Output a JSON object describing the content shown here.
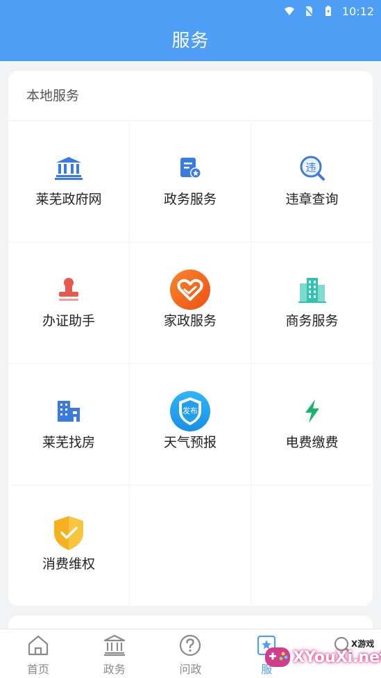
{
  "status_bar": {
    "time": "10:12"
  },
  "header": {
    "title": "服务"
  },
  "local_services": {
    "section_title": "本地服务",
    "items": [
      {
        "label": "莱芜政府网",
        "icon": "government-building-icon"
      },
      {
        "label": "政务服务",
        "icon": "document-badge-icon"
      },
      {
        "label": "违章查询",
        "icon": "violation-search-icon"
      },
      {
        "label": "办证助手",
        "icon": "stamp-icon"
      },
      {
        "label": "家政服务",
        "icon": "heart-hands-icon"
      },
      {
        "label": "商务服务",
        "icon": "office-buildings-icon"
      },
      {
        "label": "莱芜找房",
        "icon": "house-buildings-icon"
      },
      {
        "label": "天气预报",
        "icon": "shield-publish-icon",
        "badge_text": "发布"
      },
      {
        "label": "电费缴费",
        "icon": "lightning-icon"
      },
      {
        "label": "消费维权",
        "icon": "shield-check-icon"
      }
    ]
  },
  "tabbar": {
    "tabs": [
      {
        "label": "首页",
        "icon": "home-icon"
      },
      {
        "label": "政务",
        "icon": "government-icon"
      },
      {
        "label": "问政",
        "icon": "question-icon"
      },
      {
        "label": "服",
        "icon": "service-star-icon",
        "active": true
      },
      {
        "label": "",
        "icon": "search-icon"
      }
    ]
  },
  "watermark": {
    "text": "XYouXi.net",
    "small": "X游戏"
  },
  "colors": {
    "primary": "#4e9ef5",
    "red": "#e8584f",
    "orange": "#f26a1b",
    "teal": "#2fc4b2",
    "green": "#19b36b",
    "yellow": "#f5b21e"
  }
}
